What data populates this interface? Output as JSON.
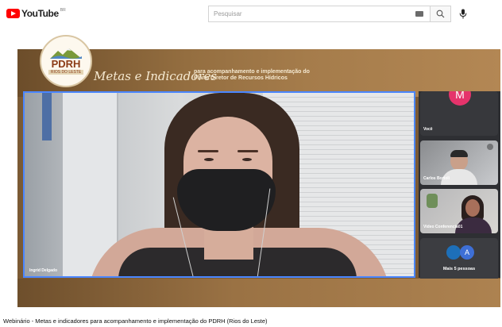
{
  "header": {
    "logo_text": "YouTube",
    "logo_region": "BR",
    "search_placeholder": "Pesquisar"
  },
  "banner": {
    "badge_title": "PDRH",
    "badge_subtitle": "RIOS DO LESTE",
    "title_script": "Metas e Indicadores",
    "title_line1": "para acompanhamento e implementação do",
    "title_line2": "Plano Diretor de Recursos Hídricos"
  },
  "meeting": {
    "main_speaker": "Ingrid Delgado",
    "participants": [
      {
        "label": "Você",
        "avatar_letter": "M",
        "avatar_color": "#e5336b"
      },
      {
        "label": "Carlos Bortoli"
      },
      {
        "label": "Video Conferencia01"
      }
    ],
    "more": {
      "avatar_letter": "A",
      "label": "Mais 5 pessoas"
    }
  },
  "video": {
    "title": "Webinário - Metas e indicadores para acompanhamento e implementação do PDRH (Rios do Leste)"
  },
  "colors": {
    "brand_red": "#ff0000",
    "active_speaker_border": "#4a86ff",
    "banner_brown": "#946e40"
  }
}
